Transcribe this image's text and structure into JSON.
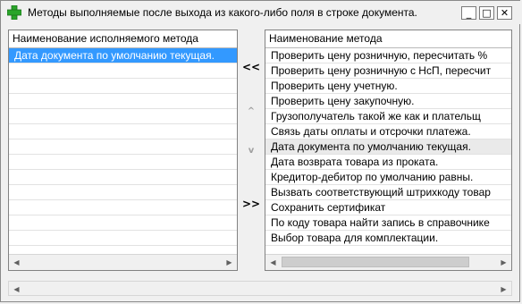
{
  "window": {
    "title": "Методы выполняемые после выхода из какого-либо поля в строке  документа.",
    "minimize_label": "_",
    "maximize_label": "□",
    "close_label": "✕"
  },
  "left_panel": {
    "header": "Наименование исполняемого метода",
    "items": [
      "Дата документа по умолчанию текущая."
    ]
  },
  "transfer_buttons": {
    "move_left_all": "<<",
    "move_up": "^",
    "move_down": "v",
    "move_right_all": ">>"
  },
  "right_panel": {
    "header": "Наименование метода",
    "items": [
      "Проверить цену розничную, пересчитать %",
      "Проверить цену розничную с НсП, пересчит",
      "Проверить цену учетную.",
      "Проверить цену закупочную.",
      "Грузополучатель такой же как и плательщ",
      "Связь даты оплаты и отсрочки платежа.",
      "Дата документа по умолчанию текущая.",
      "Дата возврата товара из проката.",
      "Кредитор-дебитор по умолчанию равны.",
      "Вызвать соответствующий штрихкоду товар",
      "Сохранить сертификат",
      "По коду товара найти запись в справочнике",
      "Выбор товара для комплектации."
    ],
    "highlighted_index": 6
  },
  "icons": {
    "app": "green-cross-icon",
    "scroll_left": "triangle-left-icon",
    "scroll_right": "triangle-right-icon"
  },
  "colors": {
    "selection_blue": "#3399ff",
    "app_icon_green": "#2aa52a"
  }
}
